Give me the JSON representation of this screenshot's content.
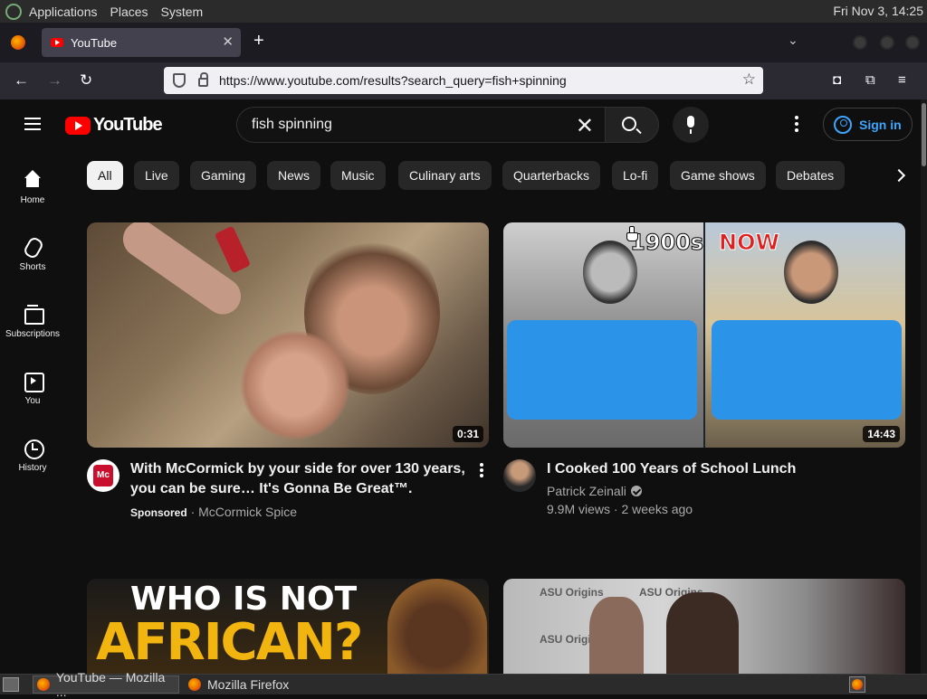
{
  "desktop": {
    "top_panel": {
      "menus": [
        "Applications",
        "Places",
        "System"
      ],
      "clock": "Fri Nov  3, 14:25"
    },
    "taskbar": {
      "items": [
        "YouTube — Mozilla ...",
        "Mozilla Firefox"
      ]
    }
  },
  "browser": {
    "tab_title": "YouTube",
    "url": "https://www.youtube.com/results?search_query=fish+spinning"
  },
  "youtube": {
    "logo_text": "YouTube",
    "search_query": "fish spinning",
    "sign_in_label": "Sign in",
    "sidebar": [
      {
        "label": "Home",
        "icon": "home-icon"
      },
      {
        "label": "Shorts",
        "icon": "shorts-icon"
      },
      {
        "label": "Subscriptions",
        "icon": "subscriptions-icon"
      },
      {
        "label": "You",
        "icon": "you-icon"
      },
      {
        "label": "History",
        "icon": "history-icon"
      }
    ],
    "chips": [
      "All",
      "Live",
      "Gaming",
      "News",
      "Music",
      "Culinary arts",
      "Quarterbacks",
      "Lo-fi",
      "Game shows",
      "Debates"
    ],
    "videos": [
      {
        "title_line1": "With McCormick by your side for over 130 years,",
        "title_line2": "you can be sure… It's Gonna Be Great™.",
        "sponsored": "Sponsored",
        "channel": "McCormick Spice",
        "duration": "0:31",
        "avatar_text": "Mc"
      },
      {
        "title": "I Cooked 100 Years of School Lunch",
        "channel": "Patrick Zeinali",
        "views": "9.9M views",
        "age": "2 weeks ago",
        "duration": "14:43",
        "thumb_left_label": "1900s",
        "thumb_right_label": "NOW"
      },
      {
        "thumb_line1": "WHO IS NOT",
        "thumb_line2": "AFRICAN?"
      },
      {
        "thumb_brand": "ASU Origins"
      }
    ],
    "colors": {
      "brand_red": "#ff0000",
      "link_blue": "#3ea6ff",
      "background": "#0f0f0f"
    }
  }
}
